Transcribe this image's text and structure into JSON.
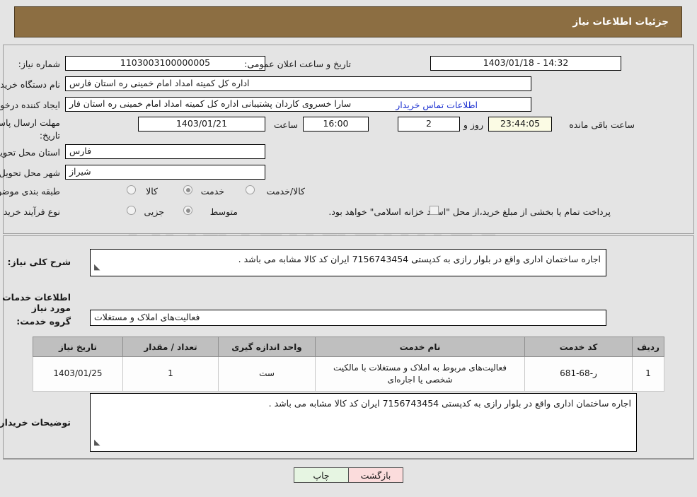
{
  "header": {
    "title": "جزئیات اطلاعات نیاز"
  },
  "form": {
    "need_number_label": "شماره نیاز:",
    "need_number_value": "1103003100000005",
    "public_announce_label": "تاریخ و ساعت اعلان عمومی:",
    "public_announce_value": "14:32 - 1403/01/18",
    "buyer_org_label": "نام دستگاه خریدار:",
    "buyer_org_value": "اداره کل کمیته امداد امام خمینی  ره  استان فارس",
    "creator_label": "ایجاد کننده درخواست:",
    "creator_value": "سارا خسروی کاردان پشتیبانی  اداره کل کمیته امداد امام خمینی  ره  استان فار",
    "contact_link": "اطلاعات تماس خریدار",
    "deadline_label_line1": "مهلت ارسال پاسخ: تا",
    "deadline_label_line2": "تاریخ:",
    "deadline_date": "1403/01/21",
    "hour_label": "ساعت",
    "hour_value": "16:00",
    "days_value": "2",
    "days_label": "روز و",
    "countdown_value": "23:44:05",
    "countdown_label": "ساعت باقی مانده",
    "province_label": "استان محل تحویل:",
    "province_value": "فارس",
    "city_label": "شهر محل تحویل:",
    "city_value": "شیراز",
    "category_label": "طبقه بندی موضوعی:",
    "category_options": [
      "کالا",
      "خدمت",
      "کالا/خدمت"
    ],
    "category_selected": "خدمت",
    "process_label": "نوع فرآیند خرید :",
    "process_options": [
      "جزیی",
      "متوسط"
    ],
    "process_selected": "متوسط",
    "treasury_checkbox_checked": false,
    "treasury_text": "پرداخت تمام یا بخشی از مبلغ خرید،از محل \"اسناد خزانه اسلامی\" خواهد بود."
  },
  "summary": {
    "label": "شرح کلی نیاز:",
    "text": "اجاره ساختمان اداری واقع در بلوار رازی به کدپستی 7156743454 ایران کد کالا مشابه می باشد ."
  },
  "services_section": {
    "heading": "اطلاعات خدمات مورد نیاز",
    "group_label": "گروه خدمت:",
    "group_value": "فعالیت‌های  املاک و مستغلات"
  },
  "table": {
    "columns": [
      "ردیف",
      "کد خدمت",
      "نام خدمت",
      "واحد اندازه گیری",
      "تعداد / مقدار",
      "تاریخ نیاز"
    ],
    "rows": [
      {
        "row": "1",
        "code": "ر-68-681",
        "name": "فعالیت‌های مربوط به املاک و مستغلات با مالکیت شخصی یا اجاره‌ای",
        "unit": "ست",
        "qty": "1",
        "date": "1403/01/25"
      }
    ]
  },
  "buyer_notes": {
    "label": "توضیحات خریدار:",
    "text": "اجاره ساختمان اداری واقع در بلوار رازی به کدپستی 7156743454 ایران کد کالا مشابه می باشد ."
  },
  "footer": {
    "print_label": "چاپ",
    "back_label": "بازگشت"
  },
  "watermark": {
    "text": "AriaTender.net"
  }
}
